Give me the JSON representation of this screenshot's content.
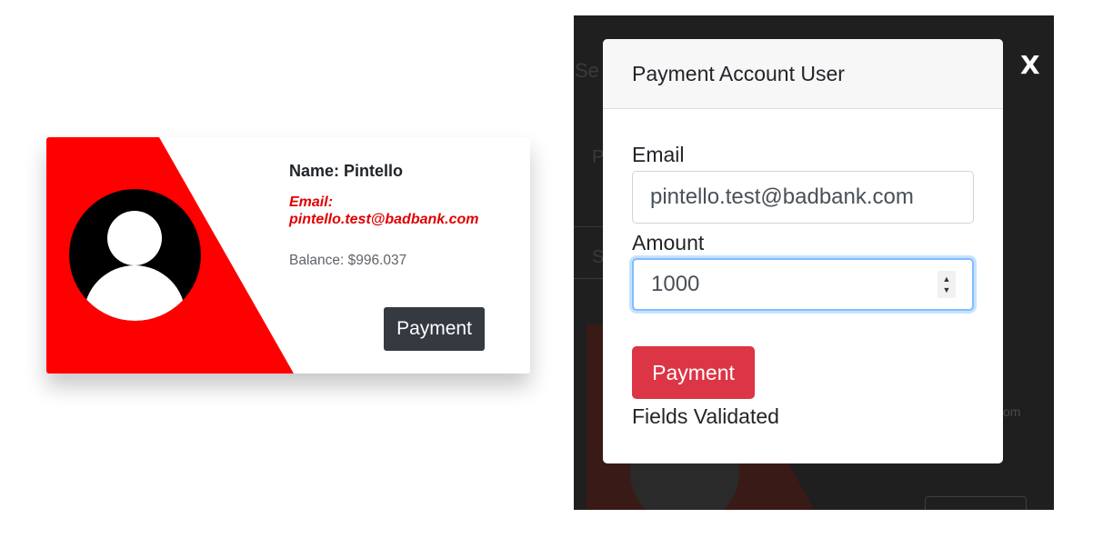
{
  "card": {
    "name": "Name: Pintello",
    "email": "Email: pintello.test@badbank.com",
    "balance": "Balance: $996.037",
    "payment_label": "Payment",
    "accent_color": "#ff0000",
    "avatar_icon": "user-avatar-icon"
  },
  "modal": {
    "title": "Payment Account User",
    "close_label": "X",
    "email_label": "Email",
    "email_value": "pintello.test@badbank.com",
    "amount_label": "Amount",
    "amount_value": "1000",
    "payment_label": "Payment",
    "status": "Fields Validated",
    "button_color": "#dc3545",
    "focus_color": "#80bdff"
  },
  "background": {
    "fragment_top": "Se",
    "fragment_mid": "P",
    "fragment_low": "S",
    "fragment_right": "om"
  }
}
